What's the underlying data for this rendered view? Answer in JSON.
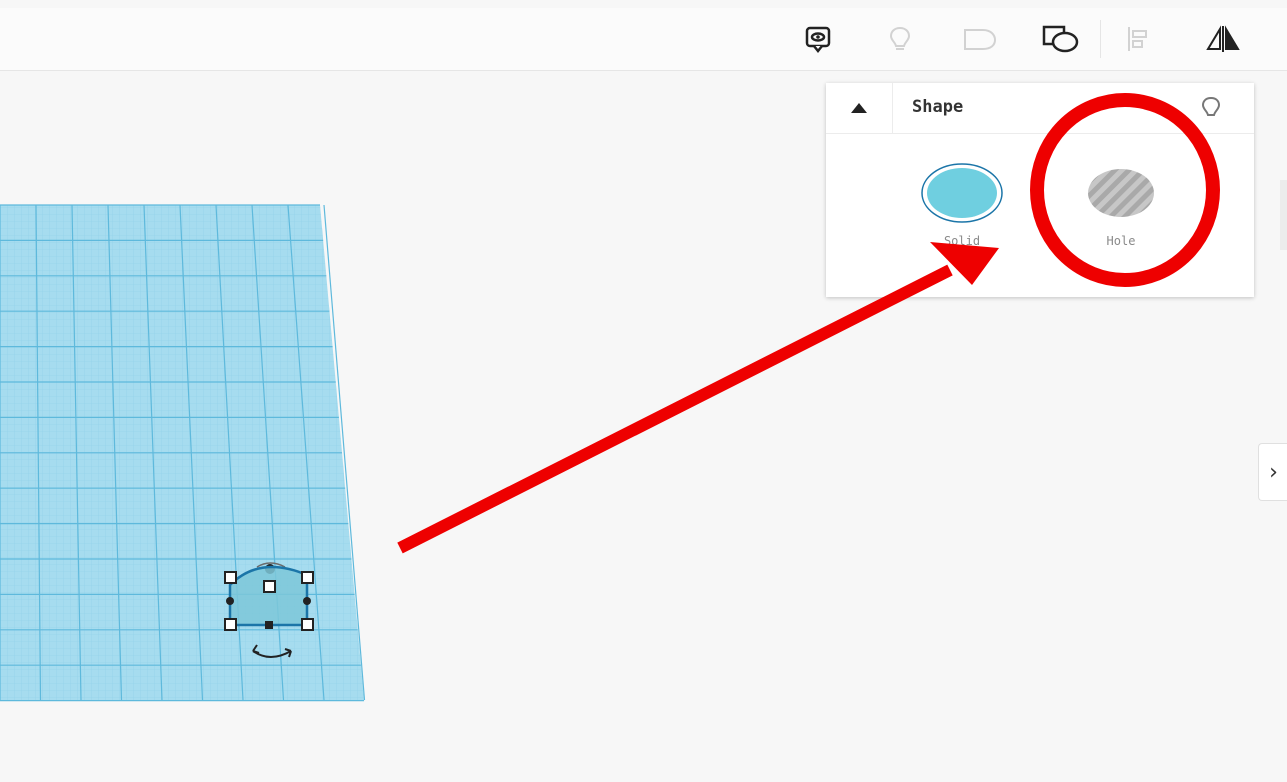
{
  "toolbar": {
    "tools": [
      {
        "icon": "note-icon",
        "tooltip": ""
      },
      {
        "icon": "light-bulb-icon",
        "tooltip": ""
      },
      {
        "icon": "group-icon",
        "tooltip": ""
      },
      {
        "icon": "ungroup-icon",
        "tooltip": ""
      },
      {
        "icon": "align-icon",
        "tooltip": ""
      },
      {
        "icon": "mirror-icon",
        "tooltip": ""
      }
    ]
  },
  "shape_panel": {
    "title": "Shape",
    "options": [
      {
        "label": "Solid",
        "color": "#6fcfe0"
      },
      {
        "label": "Hole",
        "color": "#b8b8b8"
      }
    ]
  },
  "annotation": {
    "color": "#ee0000"
  },
  "colors": {
    "workplane": "#a6dcef",
    "grid_line": "#77c6e3",
    "accent": "#1b75a8"
  }
}
